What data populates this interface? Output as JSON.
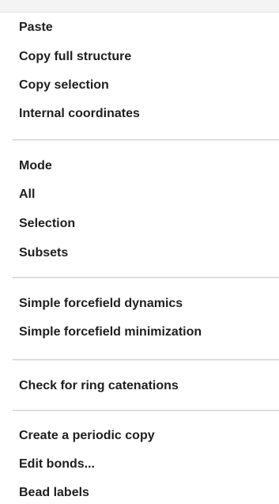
{
  "menu": {
    "group1": [
      {
        "label": "Paste"
      },
      {
        "label": "Copy full structure"
      },
      {
        "label": "Copy selection"
      },
      {
        "label": "Internal coordinates"
      }
    ],
    "group2": [
      {
        "label": "Mode",
        "arrow": "/"
      },
      {
        "label": "All",
        "arrow": "/"
      },
      {
        "label": "Selection",
        "arrow": "/"
      },
      {
        "label": "Subsets",
        "arrow": "/"
      }
    ],
    "group3": [
      {
        "label": "Simple forcefield dynamics"
      },
      {
        "label": "Simple forcefield minimization"
      }
    ],
    "group4": [
      {
        "label": "Check for ring catenations"
      }
    ],
    "group5": [
      {
        "label": "Create a periodic copy"
      },
      {
        "label": "Edit bonds..."
      },
      {
        "label": "Bead labels",
        "arrow": "/"
      }
    ]
  },
  "icons": {
    "submenu": "chevron-right-icon"
  },
  "colors": {
    "background": "#ffffff",
    "text": "#1e1e1e",
    "separator": "#cfcfcf"
  }
}
